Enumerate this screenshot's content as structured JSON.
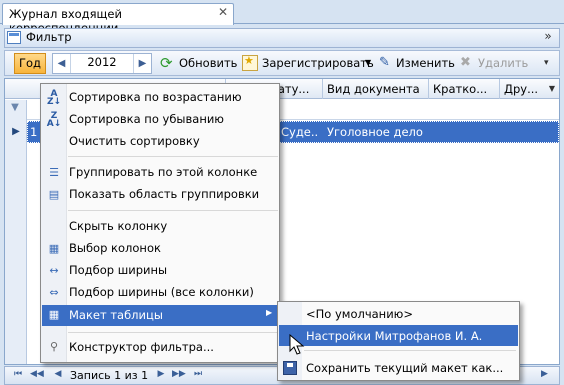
{
  "window": {
    "tab_title": "Журнал входящей корреспонденции"
  },
  "filter_bar": {
    "label": "Фильтр"
  },
  "toolbar": {
    "year_button": "Год",
    "year_value": "2012",
    "refresh_label": "Обновить",
    "register_label": "Зарегистрировать",
    "edit_label": "Изменить",
    "delete_label": "Удалить"
  },
  "grid": {
    "columns": [
      "Регистрату...",
      "Вид документа",
      "Кратко...",
      "Дру..."
    ],
    "selected_row": {
      "number": "1",
      "registrar": "Суде...",
      "doc_type": "Уголовное дело"
    }
  },
  "navigator": {
    "record_text": "Запись 1 из 1"
  },
  "context_menu": {
    "items": [
      {
        "label": "Сортировка по возрастанию",
        "icon": "sort-ascending-icon"
      },
      {
        "label": "Сортировка по убыванию",
        "icon": "sort-descending-icon"
      },
      {
        "label": "Очистить сортировку"
      },
      {
        "label": "Группировать по этой колонке",
        "icon": "group-by-icon"
      },
      {
        "label": "Показать область группировки",
        "icon": "group-panel-icon"
      },
      {
        "label": "Скрыть колонку"
      },
      {
        "label": "Выбор колонок",
        "icon": "column-chooser-icon"
      },
      {
        "label": "Подбор ширины",
        "icon": "best-fit-icon"
      },
      {
        "label": "Подбор ширины (все колонки)",
        "icon": "best-fit-all-icon"
      },
      {
        "label": "Макет таблицы",
        "icon": "layout-icon"
      },
      {
        "label": "Конструктор фильтра...",
        "icon": "filter-editor-icon"
      }
    ]
  },
  "submenu": {
    "items": [
      {
        "label": "<По умолчанию>"
      },
      {
        "label": "Настройки Митрофанов И. А."
      },
      {
        "label": "Сохранить текущий макет как...",
        "icon": "save-icon"
      }
    ]
  },
  "colors": {
    "selection": "#3a6ec5",
    "accent_orange": "#f7b43c"
  }
}
